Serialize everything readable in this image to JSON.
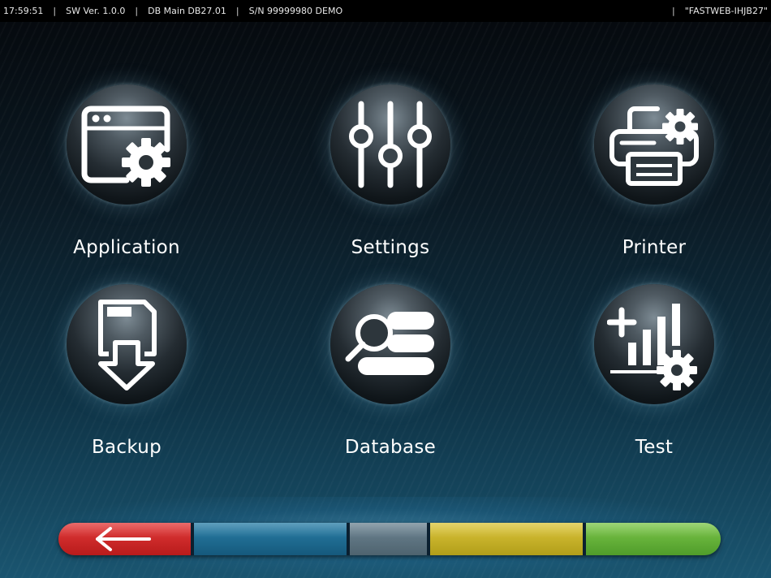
{
  "status_bar": {
    "time": "17:59:51",
    "sw_version": "SW Ver. 1.0.0",
    "db": "DB Main DB27.01",
    "serial": "S/N 99999980 DEMO",
    "separator": "|",
    "network": "\"FASTWEB-IHJB27\""
  },
  "menu": {
    "items": [
      {
        "label": "Application",
        "icon": "application-settings-icon"
      },
      {
        "label": "Settings",
        "icon": "sliders-icon"
      },
      {
        "label": "Printer",
        "icon": "printer-settings-icon"
      },
      {
        "label": "Backup",
        "icon": "backup-download-icon"
      },
      {
        "label": "Database",
        "icon": "database-search-icon"
      },
      {
        "label": "Test",
        "icon": "test-chart-settings-icon"
      }
    ]
  },
  "function_keys": {
    "keys": [
      {
        "color": "#d42a2a",
        "icon": "back-arrow-icon"
      },
      {
        "color": "#1f6e95"
      },
      {
        "color": "#5e7582"
      },
      {
        "color": "#c8b22a"
      },
      {
        "color": "#66b23a"
      }
    ]
  }
}
